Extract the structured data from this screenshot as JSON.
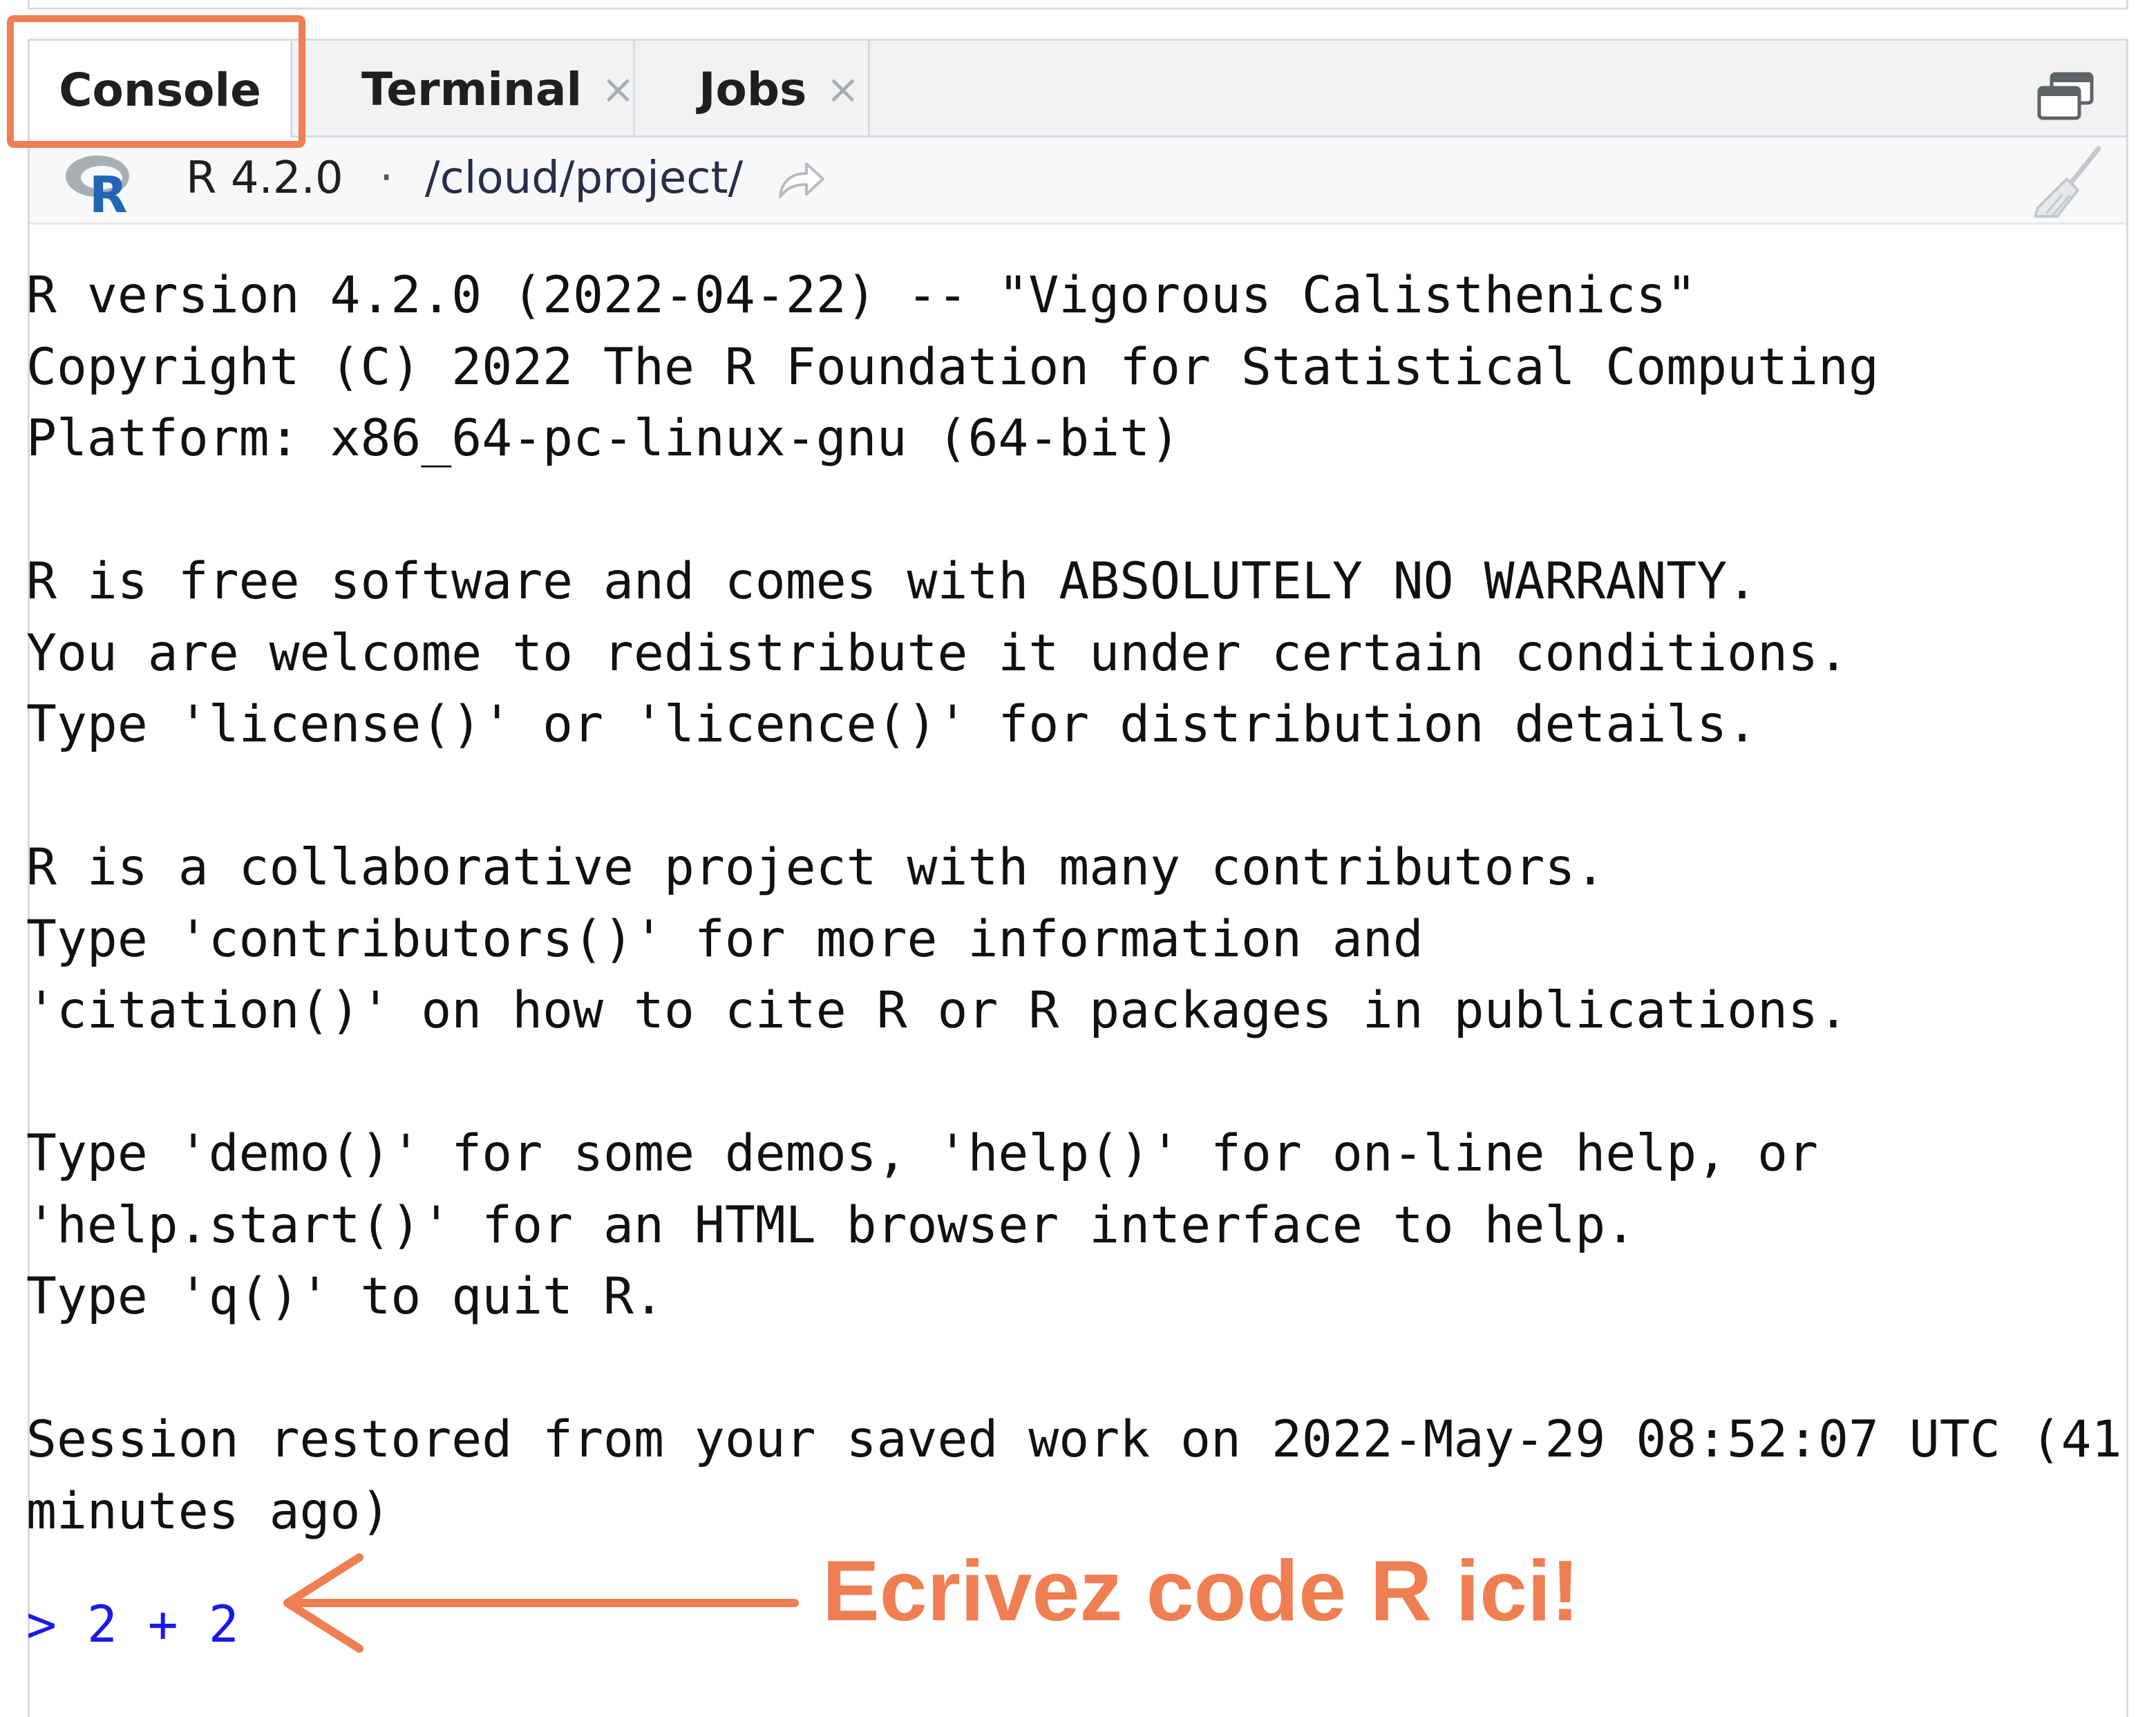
{
  "tabs": [
    {
      "label": "Console",
      "closable": false,
      "active": true
    },
    {
      "label": "Terminal",
      "closable": true,
      "active": false
    },
    {
      "label": "Jobs",
      "closable": true,
      "active": false
    }
  ],
  "tab_close_glyph": "×",
  "info_bar": {
    "r_version": "R 4.2.0",
    "separator": "·",
    "working_dir": "/cloud/project/"
  },
  "icons": {
    "maximize": "maximize-pane-icon",
    "r_logo": "r-logo-icon",
    "goto_dir": "go-to-directory-icon",
    "clear": "broom-clear-console-icon"
  },
  "console": {
    "lines": [
      "R version 4.2.0 (2022-04-22) -- \"Vigorous Calisthenics\"",
      "Copyright (C) 2022 The R Foundation for Statistical Computing",
      "Platform: x86_64-pc-linux-gnu (64-bit)",
      "",
      "R is free software and comes with ABSOLUTELY NO WARRANTY.",
      "You are welcome to redistribute it under certain conditions.",
      "Type 'license()' or 'licence()' for distribution details.",
      "",
      "R is a collaborative project with many contributors.",
      "Type 'contributors()' for more information and",
      "'citation()' on how to cite R or R packages in publications.",
      "",
      "Type 'demo()' for some demos, 'help()' for on-line help, or",
      "'help.start()' for an HTML browser interface to help.",
      "Type 'q()' to quit R.",
      "",
      "Session restored from your saved work on 2022-May-29 08:52:07 UTC (41",
      "minutes ago)"
    ],
    "prompt_input": "> 2 + 2"
  },
  "annotation": {
    "label": "Ecrivez code R ici!",
    "color": "#ef7f52"
  },
  "colors": {
    "prompt": "#1a1ae6",
    "highlight": "#ef7f52",
    "tabbar_bg": "#f0f2f4"
  }
}
